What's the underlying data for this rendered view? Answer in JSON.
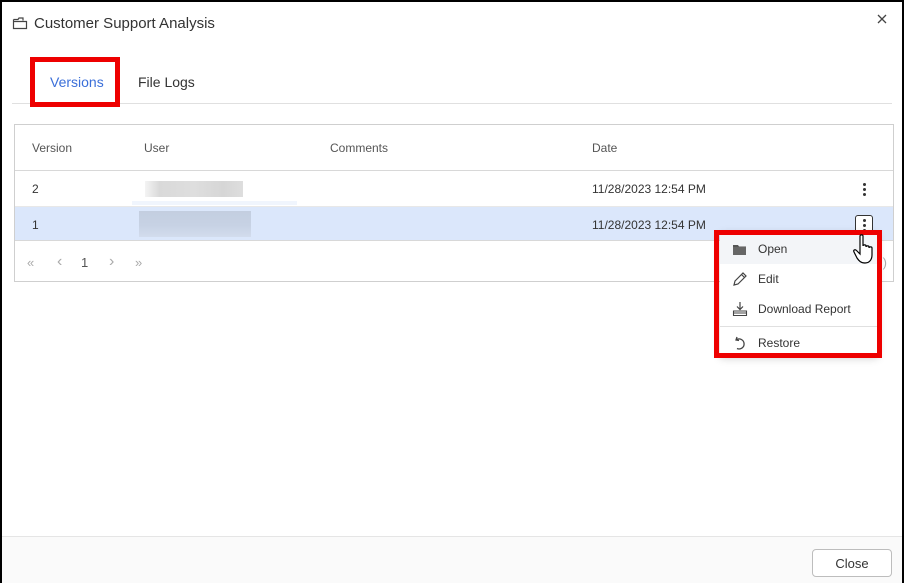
{
  "dialog": {
    "title": "Customer Support Analysis",
    "title_icon": "folder-icon",
    "close_icon": "close-icon"
  },
  "tabs": [
    {
      "label": "Versions",
      "active": true
    },
    {
      "label": "File Logs",
      "active": false
    }
  ],
  "grid": {
    "columns": [
      "Version",
      "User",
      "Comments",
      "Date"
    ],
    "rows": [
      {
        "version": "2",
        "user": "",
        "comments": "",
        "date": "11/28/2023 12:54 PM",
        "selected": false
      },
      {
        "version": "1",
        "user": "",
        "comments": "",
        "date": "11/28/2023 12:54 PM",
        "selected": true
      }
    ],
    "pager": {
      "first_icon": "«",
      "prev_icon": "‹",
      "current_page": "1",
      "next_icon": "›",
      "last_icon": "»",
      "tail": ")"
    }
  },
  "context_menu": {
    "items": [
      {
        "label": "Open",
        "icon": "folder-open-icon"
      },
      {
        "label": "Edit",
        "icon": "pencil-icon"
      },
      {
        "label": "Download Report",
        "icon": "download-icon"
      },
      {
        "label": "Restore",
        "icon": "restore-icon"
      }
    ]
  },
  "footer": {
    "close_label": "Close"
  },
  "colors": {
    "active_tab": "#3b6fd9",
    "selected_row": "#dbe7fb",
    "highlight": "#ee0000"
  }
}
